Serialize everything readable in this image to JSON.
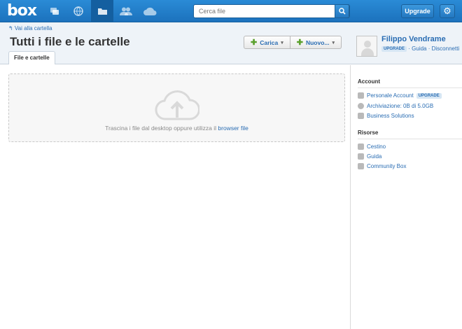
{
  "topbar": {
    "logo": "box",
    "nav_icons": [
      "updates-icon",
      "globe-icon",
      "files-icon",
      "collaborators-icon",
      "cloud-icon"
    ],
    "search_placeholder": "Cerca file",
    "upgrade_label": "Upgrade"
  },
  "header": {
    "back_link": "↰ Vai alla cartella",
    "title": "Tutti i file e le cartelle",
    "tab": "File e cartelle",
    "upload_label": "Carica",
    "new_label": "Nuovo..."
  },
  "user": {
    "name": "Filippo Vendrame",
    "upgrade_badge": "UPGRADE",
    "help_link": "Guida",
    "logout_link": "Disconnetti"
  },
  "dropzone": {
    "text": "Trascina i file dal desktop oppure utilizza il",
    "link": "browser file"
  },
  "sidebar": {
    "account_title": "Account",
    "account_items": [
      {
        "label": "Personale Account",
        "badge": "UPGRADE"
      },
      {
        "label": "Archiviazione: 0B di 5.0GB"
      },
      {
        "label": "Business Solutions"
      }
    ],
    "resources_title": "Risorse",
    "resource_items": [
      {
        "label": "Cestino"
      },
      {
        "label": "Guida"
      },
      {
        "label": "Community Box"
      }
    ]
  },
  "colors": {
    "topbar": "#1f7cc7",
    "link": "#2a6db3",
    "header_bg": "#eef3f8"
  }
}
